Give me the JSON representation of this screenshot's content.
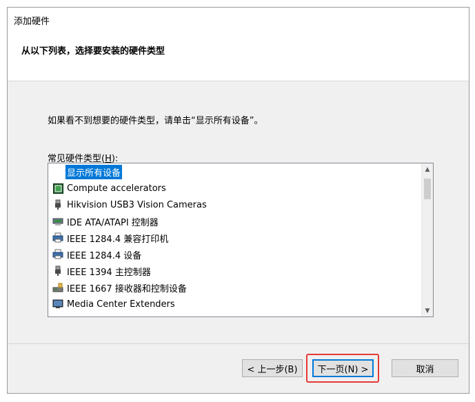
{
  "window": {
    "title": "添加硬件",
    "heading": "从以下列表，选择要安装的硬件类型"
  },
  "content": {
    "instruction": "如果看不到想要的硬件类型，请单击“显示所有设备”。",
    "list_label_prefix": "常见硬件类型(",
    "list_label_accel": "H",
    "list_label_suffix": "):"
  },
  "hardware_list": [
    {
      "label": "显示所有设备",
      "icon": "none",
      "selected": true
    },
    {
      "label": "Compute accelerators",
      "icon": "chip-icon",
      "selected": false
    },
    {
      "label": "Hikvision USB3 Vision Cameras",
      "icon": "usb-plug-icon",
      "selected": false
    },
    {
      "label": "IDE ATA/ATAPI 控制器",
      "icon": "ide-controller-icon",
      "selected": false
    },
    {
      "label": "IEEE 1284.4 兼容打印机",
      "icon": "printer-icon",
      "selected": false
    },
    {
      "label": "IEEE 1284.4 设备",
      "icon": "printer-icon",
      "selected": false
    },
    {
      "label": "IEEE 1394 主控制器",
      "icon": "usb-plug-icon",
      "selected": false
    },
    {
      "label": "IEEE 1667 接收器和控制设备",
      "icon": "storage-device-icon",
      "selected": false
    },
    {
      "label": "Media Center Extenders",
      "icon": "monitor-icon",
      "selected": false
    }
  ],
  "buttons": {
    "back": "< 上一步(B)",
    "next": "下一页(N) >",
    "cancel": "取消"
  },
  "colors": {
    "selection": "#0078d7",
    "highlight_border": "#e53935"
  }
}
